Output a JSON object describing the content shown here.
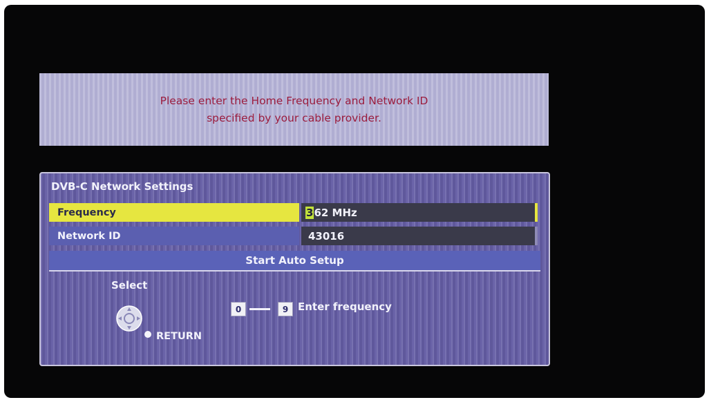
{
  "message": {
    "line1": "Please enter the Home Frequency and Network ID",
    "line2": "specified by your cable provider."
  },
  "panel": {
    "title": "DVB-C Network Settings",
    "frequency": {
      "label": "Frequency",
      "value_cursor_digit": "3",
      "value_rest": "62 MHz"
    },
    "network_id": {
      "label": "Network ID",
      "value": "43016"
    },
    "start_button_label": "Start Auto Setup"
  },
  "help": {
    "select_label": "Select",
    "return_label": "RETURN",
    "key_from": "0",
    "key_to": "9",
    "enter_hint": "Enter frequency"
  },
  "colors": {
    "highlight": "#e6e640",
    "message_text": "#9b1d3e",
    "panel_bg": "#6a63a8"
  },
  "icons": [
    "dpad-icon",
    "return-dot-icon"
  ]
}
